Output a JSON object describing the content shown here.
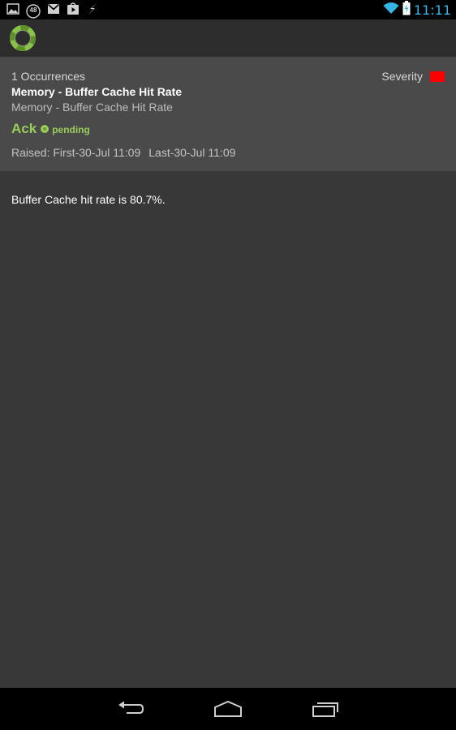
{
  "status_bar": {
    "time": "11:11",
    "notification_badge": "48",
    "icons": [
      "gallery-icon",
      "notification-count-icon",
      "gmail-icon",
      "play-store-icon",
      "usb-debug-icon",
      "wifi-icon",
      "battery-charging-icon"
    ]
  },
  "header": {
    "logo": "app-logo-ring-icon"
  },
  "alert": {
    "occurrences": "1 Occurrences",
    "severity_label": "Severity",
    "severity_color": "#ff0000",
    "title": "Memory - Buffer Cache Hit Rate",
    "subtitle": "Memory - Buffer Cache Hit Rate",
    "ack_label": "Ack",
    "status": "pending",
    "status_color": "#9acd5a",
    "raised_first": "Raised: First-30-Jul 11:09",
    "raised_last": "Last-30-Jul 11:09"
  },
  "detail": {
    "message": "Buffer Cache hit rate is 80.7%."
  },
  "nav": {
    "buttons": [
      "back-icon",
      "home-icon",
      "recent-apps-icon"
    ]
  }
}
